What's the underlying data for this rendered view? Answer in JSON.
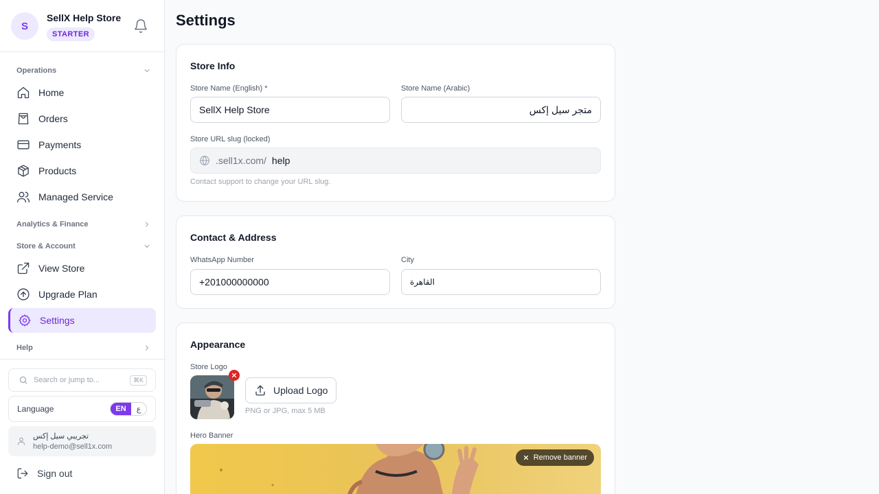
{
  "sidebar": {
    "avatar_initial": "S",
    "store_name": "SellX Help Store",
    "plan": "STARTER",
    "groups": {
      "operations": "Operations",
      "analytics": "Analytics & Finance",
      "store_account": "Store & Account",
      "help": "Help"
    },
    "items": {
      "home": "Home",
      "orders": "Orders",
      "payments": "Payments",
      "products": "Products",
      "managed_service": "Managed Service",
      "view_store": "View Store",
      "upgrade_plan": "Upgrade Plan",
      "settings": "Settings"
    },
    "search_placeholder": "Search or jump to...",
    "search_shortcut": "⌘K",
    "language_label": "Language",
    "language_en": "EN",
    "language_ar": "ع",
    "user_name": "تجريبي سيل إكس",
    "user_email": "help-demo@sell1x.com",
    "sign_out": "Sign out"
  },
  "main": {
    "title": "Settings",
    "store_info": {
      "title": "Store Info",
      "name_en_label": "Store Name (English) *",
      "name_en_value": "SellX Help Store",
      "name_ar_label": "Store Name (Arabic)",
      "name_ar_value": "متجر سيل إكس",
      "slug_label": "Store URL slug (locked)",
      "slug_prefix": ".sell1x.com/",
      "slug_value": "help",
      "slug_hint": "Contact support to change your URL slug."
    },
    "contact": {
      "title": "Contact & Address",
      "whatsapp_label": "WhatsApp Number",
      "whatsapp_value": "+201000000000",
      "city_label": "City",
      "city_value": "القاهرة"
    },
    "appearance": {
      "title": "Appearance",
      "logo_label": "Store Logo",
      "upload_logo": "Upload Logo",
      "logo_hint": "PNG or JPG, max 5 MB",
      "banner_label": "Hero Banner",
      "remove_banner": "Remove banner"
    }
  },
  "colors": {
    "accent": "#7c3aed",
    "accent_soft": "#ede9fe",
    "danger": "#dc2626"
  }
}
